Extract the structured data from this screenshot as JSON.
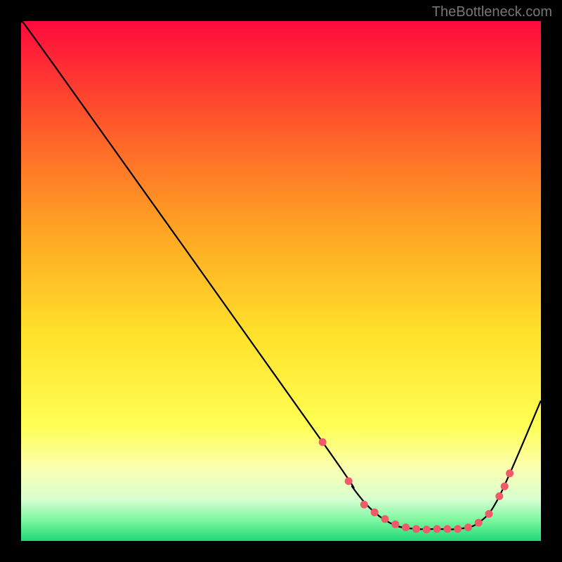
{
  "attribution": "TheBottleneck.com",
  "chart_data": {
    "type": "line",
    "title": "",
    "xlabel": "",
    "ylabel": "",
    "xlim": [
      0,
      100
    ],
    "ylim": [
      0,
      100
    ],
    "gradient_bands": [
      {
        "pos": 0.0,
        "color": "#ff0a3c"
      },
      {
        "pos": 0.2,
        "color": "#ff5a2a"
      },
      {
        "pos": 0.4,
        "color": "#ffa423"
      },
      {
        "pos": 0.6,
        "color": "#ffe12a"
      },
      {
        "pos": 0.78,
        "color": "#ffff55"
      },
      {
        "pos": 0.86,
        "color": "#fbffb0"
      },
      {
        "pos": 0.92,
        "color": "#d7ffd0"
      },
      {
        "pos": 0.96,
        "color": "#7cf7a0"
      },
      {
        "pos": 1.0,
        "color": "#1ed977"
      }
    ],
    "curve": {
      "description": "bottleneck curve (V shape) with rounded minimum; pink dots highlight the flat minimum region",
      "x": [
        0,
        6,
        58,
        64,
        68,
        72,
        76,
        80,
        84,
        88,
        92,
        100
      ],
      "y": [
        100,
        92,
        19,
        10,
        5.5,
        3,
        2.3,
        2.3,
        2.3,
        3.5,
        8.6,
        27
      ]
    },
    "dots": {
      "color": "#f15a68",
      "x": [
        58,
        63,
        66,
        68,
        70,
        72,
        74,
        76,
        78,
        80,
        82,
        84,
        86,
        88,
        90,
        92,
        93,
        94
      ],
      "y": [
        19,
        11.5,
        7,
        5.5,
        4.2,
        3.2,
        2.6,
        2.3,
        2.2,
        2.3,
        2.3,
        2.3,
        2.6,
        3.5,
        5.2,
        8.6,
        10.5,
        13
      ]
    }
  }
}
